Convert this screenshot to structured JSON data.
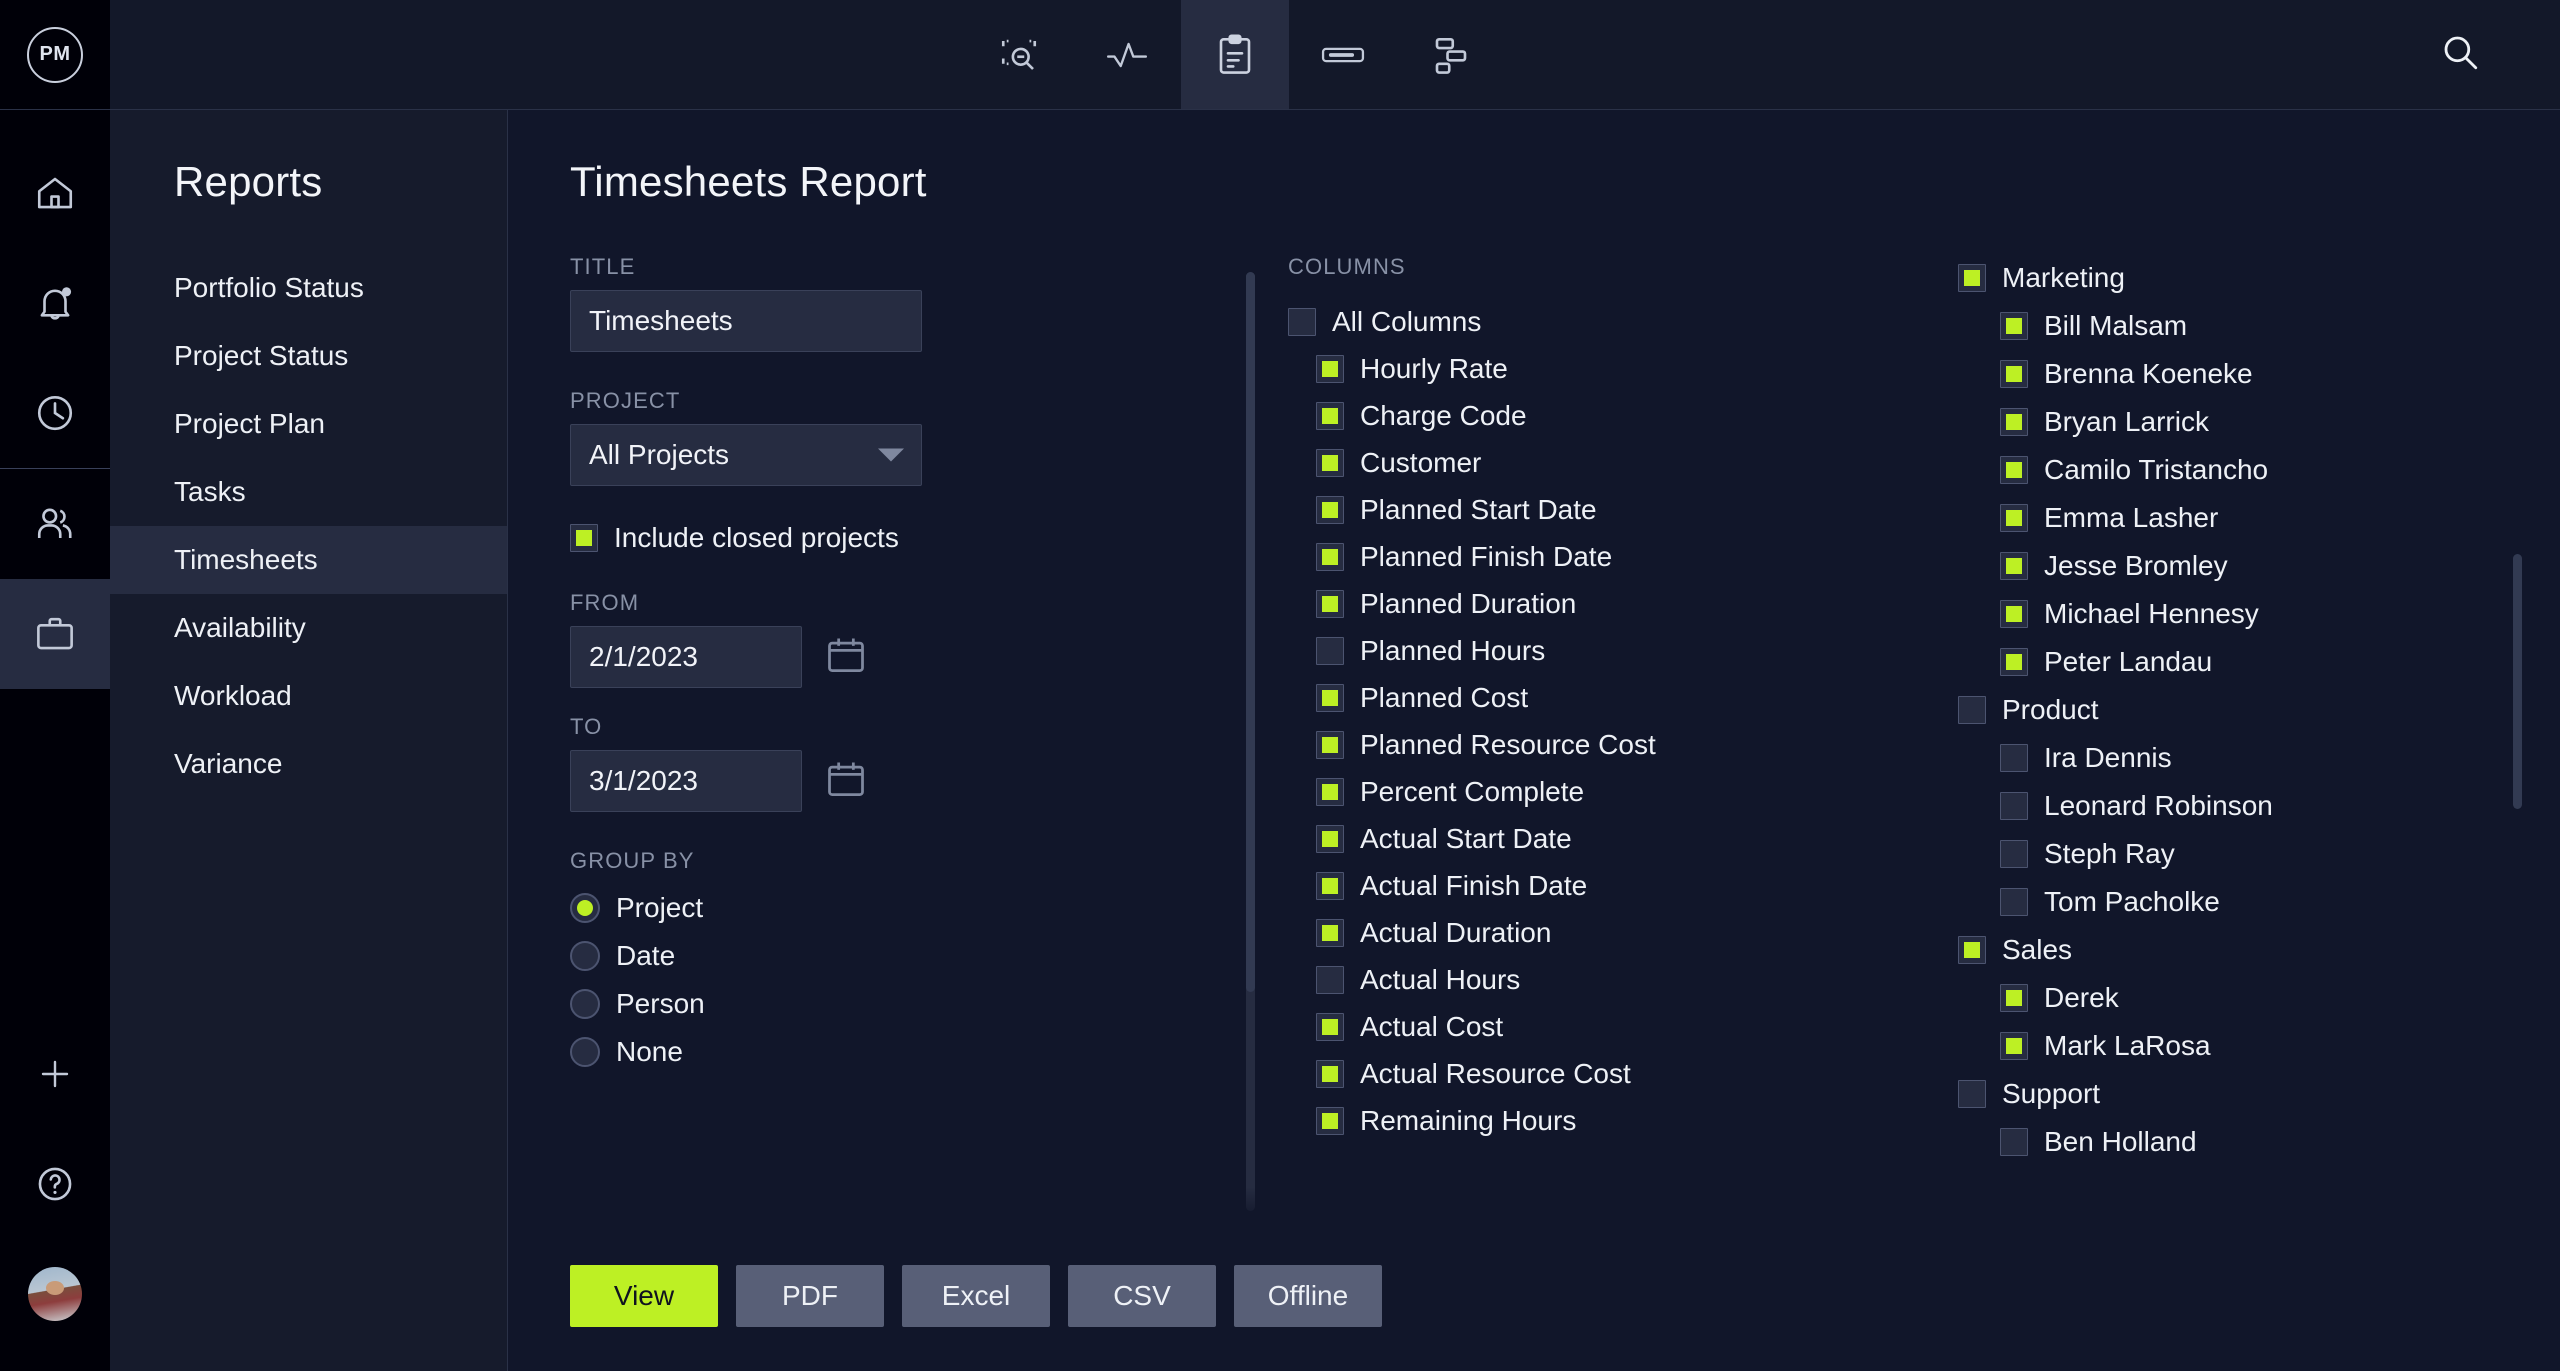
{
  "topbar": {
    "logo_text": "PM",
    "nav": [
      {
        "icon": "overview-zoom-icon",
        "active": false
      },
      {
        "icon": "activity-pulse-icon",
        "active": false
      },
      {
        "icon": "clipboard-icon",
        "active": true
      },
      {
        "icon": "list-bar-icon",
        "active": false
      },
      {
        "icon": "gantt-hierarchy-icon",
        "active": false
      }
    ],
    "search_icon": "search-icon"
  },
  "rail": {
    "items": [
      {
        "icon": "home-icon",
        "active": false
      },
      {
        "icon": "bell-notification-icon",
        "active": false
      },
      {
        "icon": "clock-icon",
        "active": false
      },
      {
        "icon": "people-icon",
        "active": false
      },
      {
        "icon": "briefcase-icon",
        "active": true
      }
    ],
    "bottom": [
      {
        "icon": "plus-icon"
      },
      {
        "icon": "help-circle-icon"
      },
      {
        "icon": "avatar"
      }
    ]
  },
  "reports": {
    "title": "Reports",
    "items": [
      {
        "label": "Portfolio Status",
        "active": false
      },
      {
        "label": "Project Status",
        "active": false
      },
      {
        "label": "Project Plan",
        "active": false
      },
      {
        "label": "Tasks",
        "active": false
      },
      {
        "label": "Timesheets",
        "active": true
      },
      {
        "label": "Availability",
        "active": false
      },
      {
        "label": "Workload",
        "active": false
      },
      {
        "label": "Variance",
        "active": false
      }
    ]
  },
  "main": {
    "page_title": "Timesheets Report",
    "form": {
      "title_label": "TITLE",
      "title_value": "Timesheets",
      "project_label": "PROJECT",
      "project_value": "All Projects",
      "include_closed_label": "Include closed projects",
      "include_closed_checked": true,
      "from_label": "FROM",
      "from_value": "2/1/2023",
      "to_label": "TO",
      "to_value": "3/1/2023",
      "group_by_label": "GROUP BY",
      "group_by_options": [
        {
          "label": "Project",
          "selected": true
        },
        {
          "label": "Date",
          "selected": false
        },
        {
          "label": "Person",
          "selected": false
        },
        {
          "label": "None",
          "selected": false
        }
      ]
    },
    "columns": {
      "label": "COLUMNS",
      "items": [
        {
          "label": "All Columns",
          "checked": false,
          "child": false
        },
        {
          "label": "Hourly Rate",
          "checked": true,
          "child": true
        },
        {
          "label": "Charge Code",
          "checked": true,
          "child": true
        },
        {
          "label": "Customer",
          "checked": true,
          "child": true
        },
        {
          "label": "Planned Start Date",
          "checked": true,
          "child": true
        },
        {
          "label": "Planned Finish Date",
          "checked": true,
          "child": true
        },
        {
          "label": "Planned Duration",
          "checked": true,
          "child": true
        },
        {
          "label": "Planned Hours",
          "checked": false,
          "child": true
        },
        {
          "label": "Planned Cost",
          "checked": true,
          "child": true
        },
        {
          "label": "Planned Resource Cost",
          "checked": true,
          "child": true
        },
        {
          "label": "Percent Complete",
          "checked": true,
          "child": true
        },
        {
          "label": "Actual Start Date",
          "checked": true,
          "child": true
        },
        {
          "label": "Actual Finish Date",
          "checked": true,
          "child": true
        },
        {
          "label": "Actual Duration",
          "checked": true,
          "child": true
        },
        {
          "label": "Actual Hours",
          "checked": false,
          "child": true
        },
        {
          "label": "Actual Cost",
          "checked": true,
          "child": true
        },
        {
          "label": "Actual Resource Cost",
          "checked": true,
          "child": true
        },
        {
          "label": "Remaining Hours",
          "checked": true,
          "child": true
        }
      ]
    },
    "people": {
      "items": [
        {
          "label": "Marketing",
          "checked": true,
          "child": false
        },
        {
          "label": "Bill Malsam",
          "checked": true,
          "child": true
        },
        {
          "label": "Brenna Koeneke",
          "checked": true,
          "child": true
        },
        {
          "label": "Bryan Larrick",
          "checked": true,
          "child": true
        },
        {
          "label": "Camilo Tristancho",
          "checked": true,
          "child": true
        },
        {
          "label": "Emma Lasher",
          "checked": true,
          "child": true
        },
        {
          "label": "Jesse Bromley",
          "checked": true,
          "child": true
        },
        {
          "label": "Michael Hennesy",
          "checked": true,
          "child": true
        },
        {
          "label": "Peter Landau",
          "checked": true,
          "child": true
        },
        {
          "label": "Product",
          "checked": false,
          "child": false
        },
        {
          "label": "Ira Dennis",
          "checked": false,
          "child": true
        },
        {
          "label": "Leonard Robinson",
          "checked": false,
          "child": true
        },
        {
          "label": "Steph Ray",
          "checked": false,
          "child": true
        },
        {
          "label": "Tom Pacholke",
          "checked": false,
          "child": true
        },
        {
          "label": "Sales",
          "checked": true,
          "child": false
        },
        {
          "label": "Derek",
          "checked": true,
          "child": true
        },
        {
          "label": "Mark LaRosa",
          "checked": true,
          "child": true
        },
        {
          "label": "Support",
          "checked": false,
          "child": false
        },
        {
          "label": "Ben Holland",
          "checked": false,
          "child": true
        }
      ]
    },
    "actions": [
      {
        "label": "View",
        "primary": true
      },
      {
        "label": "PDF",
        "primary": false
      },
      {
        "label": "Excel",
        "primary": false
      },
      {
        "label": "CSV",
        "primary": false
      },
      {
        "label": "Offline",
        "primary": false
      }
    ]
  },
  "colors": {
    "accent": "#bdf024",
    "bg": "#11162a",
    "panel": "#161b2c",
    "rail": "#000008",
    "field": "#262c41",
    "button": "#585f77"
  }
}
